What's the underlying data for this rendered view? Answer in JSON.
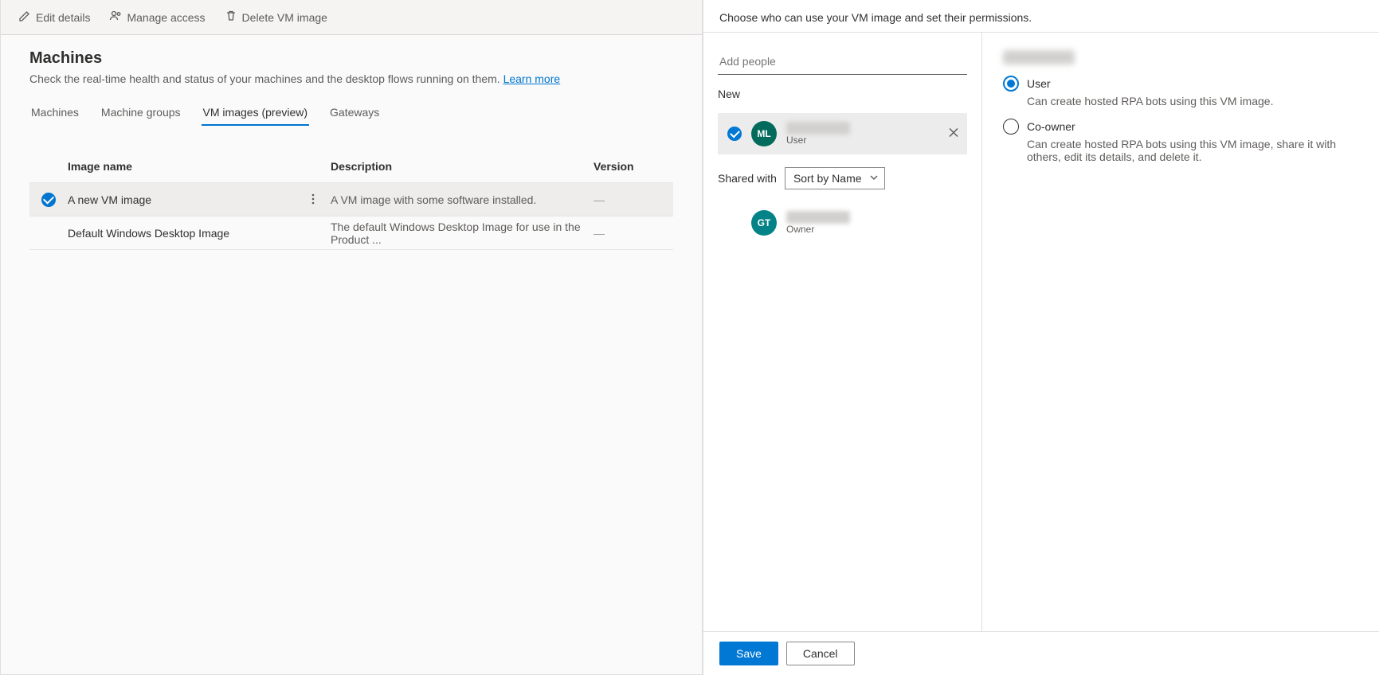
{
  "toolbar": {
    "edit": "Edit details",
    "manage": "Manage access",
    "delete": "Delete VM image"
  },
  "page": {
    "title": "Machines",
    "subtitle_pre": "Check the real-time health and status of your machines and the desktop flows running on them. ",
    "learn_more": "Learn more"
  },
  "tabs": [
    {
      "label": "Machines",
      "active": false
    },
    {
      "label": "Machine groups",
      "active": false
    },
    {
      "label": "VM images (preview)",
      "active": true
    },
    {
      "label": "Gateways",
      "active": false
    }
  ],
  "table": {
    "headers": {
      "name": "Image name",
      "desc": "Description",
      "version": "Version"
    },
    "rows": [
      {
        "selected": true,
        "name": "A new VM image",
        "desc": "A VM image with some software installed.",
        "version": "—"
      },
      {
        "selected": false,
        "name": "Default Windows Desktop Image",
        "desc": "The default Windows Desktop Image for use in the Product ...",
        "version": "—"
      }
    ]
  },
  "panel": {
    "description": "Choose who can use your VM image and set their permissions.",
    "add_placeholder": "Add people",
    "new_label": "New",
    "new_person": {
      "initials": "ML",
      "role": "User"
    },
    "shared_label": "Shared with",
    "sort_value": "Sort by Name",
    "shared_person": {
      "initials": "GT",
      "role": "Owner"
    },
    "permissions": [
      {
        "label": "User",
        "desc": "Can create hosted RPA bots using this VM image.",
        "checked": true
      },
      {
        "label": "Co-owner",
        "desc": "Can create hosted RPA bots using this VM image, share it with others, edit its details, and delete it.",
        "checked": false
      }
    ],
    "save": "Save",
    "cancel": "Cancel"
  }
}
